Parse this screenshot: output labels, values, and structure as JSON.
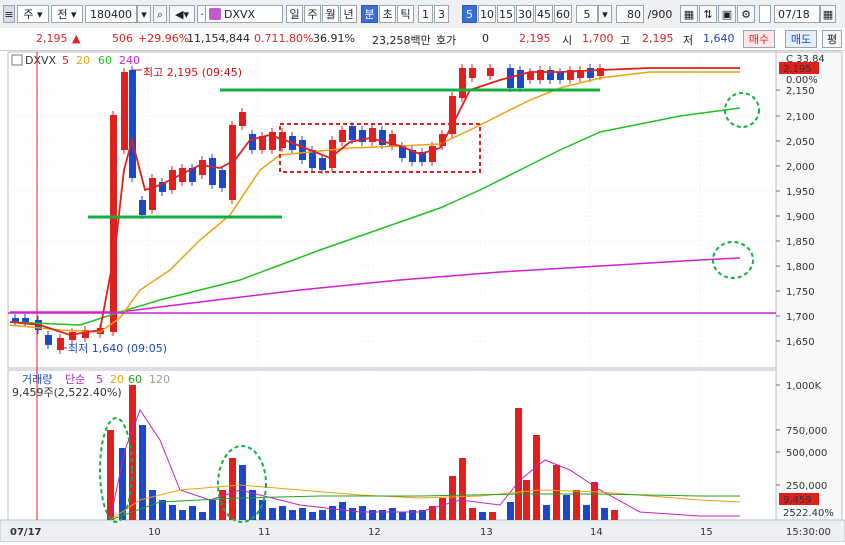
{
  "toolbar": {
    "market": "주",
    "type": "전",
    "code": "180400",
    "name": "DXVX",
    "periods": [
      "일",
      "주",
      "월",
      "년",
      "분",
      "초",
      "틱"
    ],
    "minutes": [
      "1",
      "3",
      "5",
      "10",
      "15",
      "30",
      "45",
      "60"
    ],
    "interval": "5",
    "count": "80",
    "count_total": "/900",
    "date": "07/18"
  },
  "quote": {
    "price": "2,195",
    "change": "506",
    "change_pct": "+29.96%",
    "volume": "11,154,844",
    "vol_ratio": "0.711.80%",
    "turnover": "36.91%",
    "amount": "23,258백만",
    "hoga_label": "호가",
    "hoga": "0",
    "price2": "2,195",
    "open_label": "시",
    "open": "1,700",
    "high_label": "고",
    "high": "2,195",
    "low_label": "저",
    "low": "1,640",
    "buy_btn": "매수",
    "sell_btn": "매도",
    "eval_btn": "평"
  },
  "price_panel": {
    "legend_name": "DXVX",
    "ma_labels": [
      "5",
      "20",
      "60",
      "240"
    ],
    "ma_colors": [
      "#e0201e",
      "#f0a010",
      "#20c020",
      "#d020d0"
    ],
    "high_note": "최고 2,195 (09:45)",
    "low_note": "최저 1,640 (09:05)",
    "top_right": "C 33.84",
    "current_tag": "2,195",
    "zero_tag": "0.00%",
    "y_ticks": [
      "2,150",
      "2,100",
      "2,050",
      "2,000",
      "1,950",
      "1,900",
      "1,850",
      "1,800",
      "1,750",
      "1,700",
      "1,650"
    ]
  },
  "volume_panel": {
    "legend": [
      "거래량",
      "단순",
      "5",
      "20",
      "60",
      "120"
    ],
    "info": "9,459주(2,522.40%)",
    "y_ticks": [
      "1,000K",
      "750,000",
      "500,000",
      "250,000"
    ],
    "current_tag": "9,459",
    "pct_tag": "2522.40%"
  },
  "x_axis": {
    "start_date": "07/17",
    "hours": [
      "10",
      "11",
      "12",
      "13",
      "14",
      "15"
    ],
    "end_time": "15:30:00"
  }
}
